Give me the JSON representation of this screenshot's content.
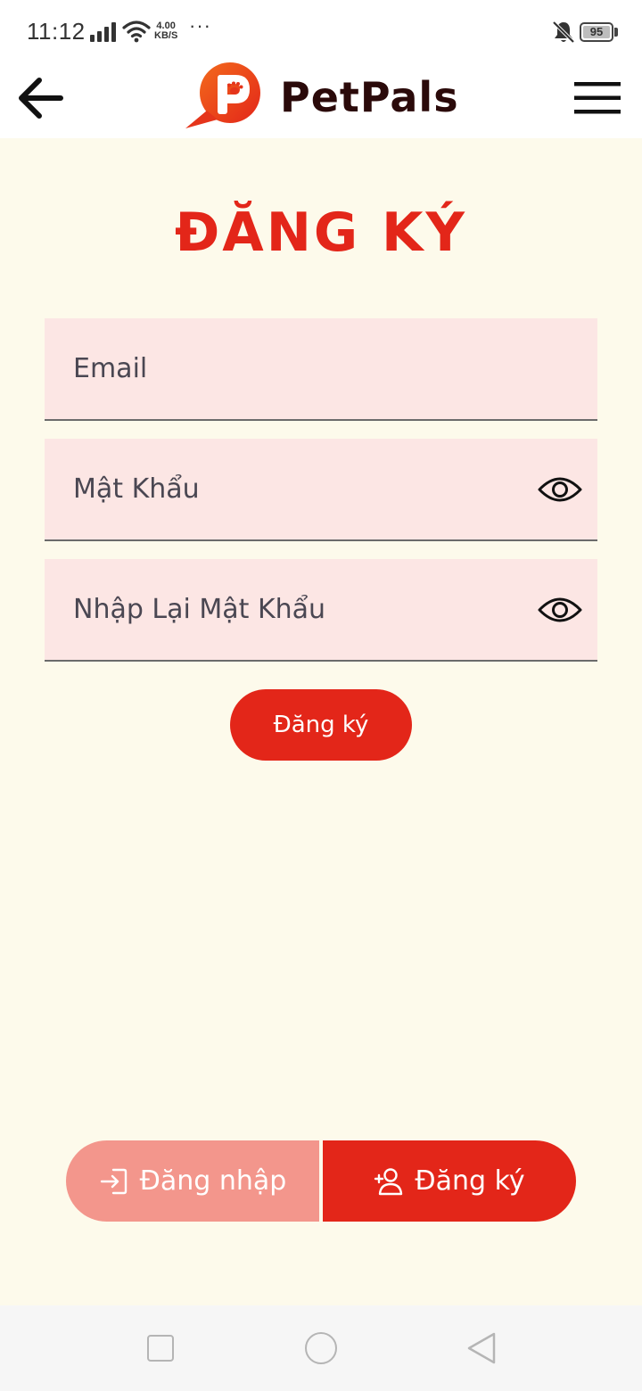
{
  "status_bar": {
    "time": "11:12",
    "net_speed_value": "4.00",
    "net_speed_unit": "KB/S",
    "overflow": "···",
    "battery": "95"
  },
  "header": {
    "brand": "PetPals",
    "brand_color": "#e32619",
    "back_icon": "arrow-left-icon",
    "menu_icon": "hamburger-menu-icon"
  },
  "page": {
    "title": "ĐĂNG KÝ"
  },
  "form": {
    "email_placeholder": "Email",
    "password_placeholder": "Mật Khẩu",
    "confirm_placeholder": "Nhập Lại Mật Khẩu",
    "submit_label": "Đăng ký"
  },
  "auth_toggle": {
    "login_label": "Đăng nhập",
    "register_label": "Đăng ký",
    "active": "register"
  },
  "colors": {
    "primary": "#e32619",
    "primary_light": "#f3968c",
    "background": "#fdfaeb",
    "field_bg": "#fce6e4"
  }
}
